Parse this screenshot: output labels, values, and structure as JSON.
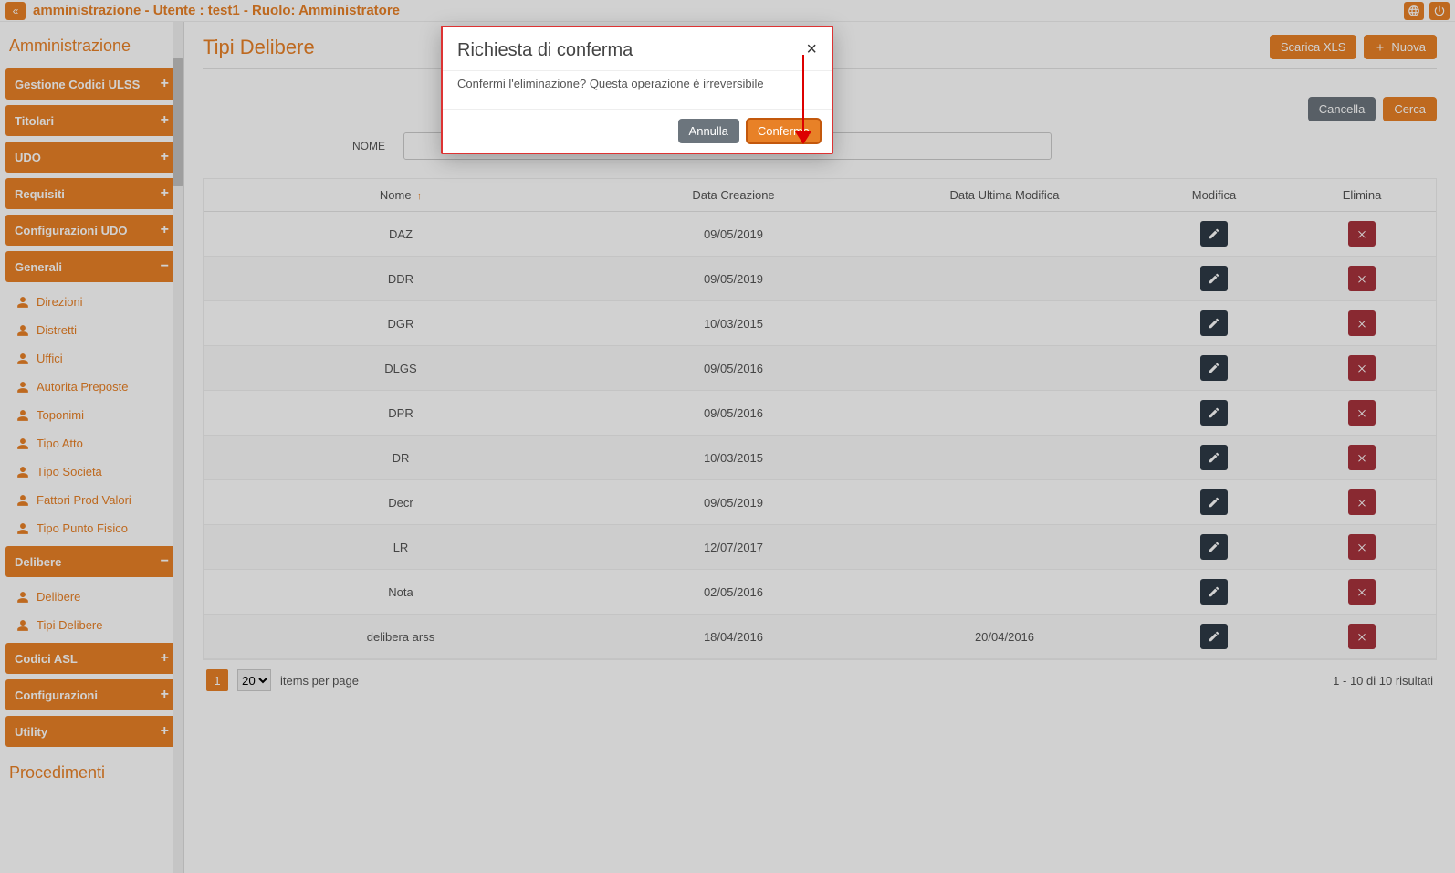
{
  "header": {
    "title": "amministrazione - Utente : test1 - Ruolo: Amministratore"
  },
  "sidebar": {
    "heading": "Amministrazione",
    "items": [
      {
        "label": "Gestione Codici ULSS",
        "open": false
      },
      {
        "label": "Titolari",
        "open": false
      },
      {
        "label": "UDO",
        "open": false
      },
      {
        "label": "Requisiti",
        "open": false
      },
      {
        "label": "Configurazioni UDO",
        "open": false
      },
      {
        "label": "Generali",
        "open": true,
        "children": [
          "Direzioni",
          "Distretti",
          "Uffici",
          "Autorita Preposte",
          "Toponimi",
          "Tipo Atto",
          "Tipo Societa",
          "Fattori Prod Valori",
          "Tipo Punto Fisico"
        ]
      },
      {
        "label": "Delibere",
        "open": true,
        "children": [
          "Delibere",
          "Tipi Delibere"
        ]
      },
      {
        "label": "Codici ASL",
        "open": false
      },
      {
        "label": "Configurazioni",
        "open": false
      },
      {
        "label": "Utility",
        "open": false
      }
    ],
    "subheading": "Procedimenti"
  },
  "page": {
    "title": "Tipi Delibere",
    "download_label": "Scarica XLS",
    "new_label": "Nuova",
    "search": {
      "field_label": "NOME",
      "clear": "Cancella",
      "submit": "Cerca"
    }
  },
  "table": {
    "headers": {
      "nome": "Nome",
      "created": "Data Creazione",
      "modified": "Data Ultima Modifica",
      "edit": "Modifica",
      "del": "Elimina"
    },
    "rows": [
      {
        "nome": "DAZ",
        "created": "09/05/2019",
        "modified": ""
      },
      {
        "nome": "DDR",
        "created": "09/05/2019",
        "modified": ""
      },
      {
        "nome": "DGR",
        "created": "10/03/2015",
        "modified": ""
      },
      {
        "nome": "DLGS",
        "created": "09/05/2016",
        "modified": ""
      },
      {
        "nome": "DPR",
        "created": "09/05/2016",
        "modified": ""
      },
      {
        "nome": "DR",
        "created": "10/03/2015",
        "modified": ""
      },
      {
        "nome": "Decr",
        "created": "09/05/2019",
        "modified": ""
      },
      {
        "nome": "LR",
        "created": "12/07/2017",
        "modified": ""
      },
      {
        "nome": "Nota",
        "created": "02/05/2016",
        "modified": ""
      },
      {
        "nome": "delibera arss",
        "created": "18/04/2016",
        "modified": "20/04/2016"
      }
    ]
  },
  "pager": {
    "page": "1",
    "per_page": "20",
    "per_page_label": "items per page",
    "results": "1 - 10 di 10 risultati"
  },
  "modal": {
    "title": "Richiesta di conferma",
    "body": "Confermi l'eliminazione? Questa operazione è irreversibile",
    "cancel": "Annulla",
    "confirm": "Conferma"
  }
}
